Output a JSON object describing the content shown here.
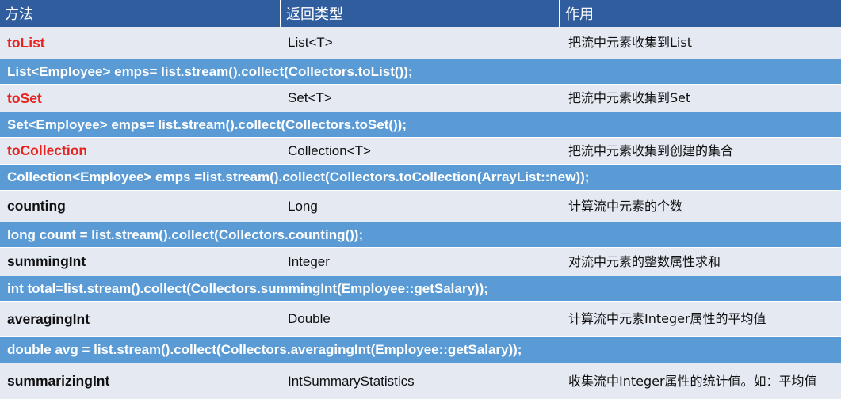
{
  "header": {
    "col1": "方法",
    "col2": "返回类型",
    "col3": "作用"
  },
  "rows": [
    {
      "method": "toList",
      "return_type": "List<T>",
      "description": "把流中元素收集到List",
      "example": "List<Employee> emps= list.stream().collect(Collectors.toList());"
    },
    {
      "method": "toSet",
      "return_type": "Set<T>",
      "description": "把流中元素收集到Set",
      "example": "Set<Employee> emps= list.stream().collect(Collectors.toSet());"
    },
    {
      "method": "toCollection",
      "return_type": "Collection<T>",
      "description": "把流中元素收集到创建的集合",
      "example": "Collection<Employee> emps =list.stream().collect(Collectors.toCollection(ArrayList::new));"
    },
    {
      "method": "counting",
      "return_type": "Long",
      "description": "计算流中元素的个数",
      "example": "long count = list.stream().collect(Collectors.counting());"
    },
    {
      "method": "summingInt",
      "return_type": "Integer",
      "description": "对流中元素的整数属性求和",
      "example": "int total=list.stream().collect(Collectors.summingInt(Employee::getSalary));"
    },
    {
      "method": "averagingInt",
      "return_type": "Double",
      "description": "计算流中元素Integer属性的平均值",
      "example": "double avg = list.stream().collect(Collectors.averagingInt(Employee::getSalary));"
    },
    {
      "method": "summarizingInt",
      "return_type": "IntSummaryStatistics",
      "description": "收集流中Integer属性的统计值。如：平均值"
    }
  ],
  "colors": {
    "header_bg": "#2f5d9e",
    "code_row_bg": "#5b9bd5",
    "data_row_bg": "#e4e9f2",
    "method_red": "#e8231f"
  }
}
